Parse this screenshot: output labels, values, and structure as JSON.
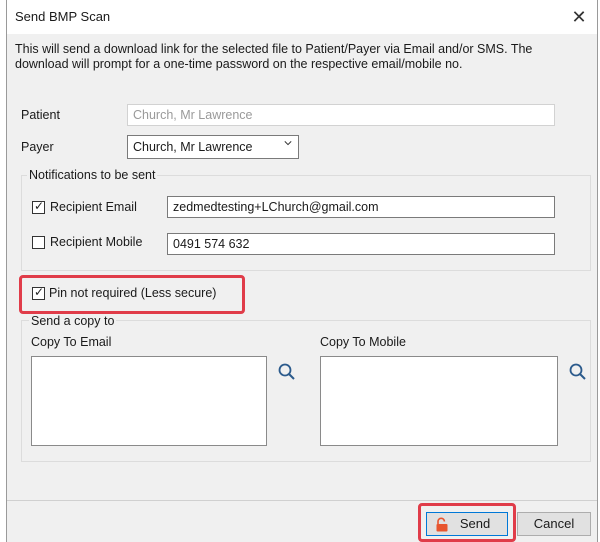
{
  "dialog": {
    "title": "Send BMP Scan",
    "close_glyph": "✕",
    "description": "This will send a download link for the selected file to Patient/Payer via Email and/or SMS. The download will prompt for a one-time password on the respective email/mobile no."
  },
  "patient": {
    "label": "Patient",
    "value": "Church, Mr Lawrence"
  },
  "payer": {
    "label": "Payer",
    "value": "Church, Mr Lawrence"
  },
  "notifications": {
    "title": "Notifications to be sent",
    "email": {
      "label": "Recipient Email",
      "checked": true,
      "value": "zedmedtesting+LChurch@gmail.com"
    },
    "mobile": {
      "label": "Recipient Mobile",
      "checked": false,
      "value": "0491 574 632"
    }
  },
  "pin": {
    "label": "Pin not required (Less secure)",
    "checked": true
  },
  "copy": {
    "title": "Send a copy to",
    "email_label": "Copy To Email",
    "mobile_label": "Copy To Mobile"
  },
  "buttons": {
    "send": "Send",
    "cancel": "Cancel"
  },
  "icons": {
    "close": "close-icon",
    "chevron": "chevron-down-icon",
    "check": "checkmark-icon",
    "search": "search-icon",
    "lock": "unlocked-padlock-icon"
  },
  "colors": {
    "highlight": "#e03c49",
    "lock": "#e8552f",
    "focus": "#0078d7"
  }
}
